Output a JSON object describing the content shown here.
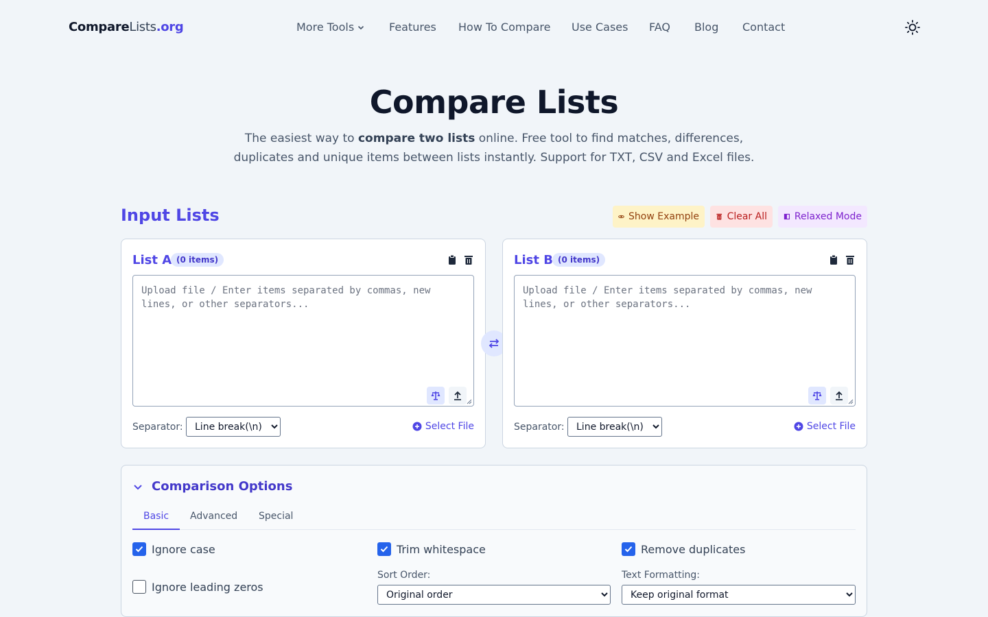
{
  "brand": {
    "part1": "Compare",
    "part2": "Lists",
    "part3": ".org"
  },
  "nav": [
    "More Tools",
    "Features",
    "How To Compare",
    "Use Cases",
    "FAQ",
    "Blog",
    "Contact"
  ],
  "hero": {
    "title": "Compare Lists",
    "sub_pre": "The easiest way to ",
    "sub_bold": "compare two lists",
    "sub_post": " online. Free tool to find matches, differences, duplicates and unique items between lists instantly. Support for TXT, CSV and Excel files."
  },
  "input": {
    "title": "Input Lists",
    "show_example": "Show Example",
    "clear_all": "Clear All",
    "relaxed_mode": "Relaxed Mode"
  },
  "lists": {
    "a": {
      "title": "List A",
      "count": "(0 items)",
      "placeholder": "Upload file / Enter items separated by commas, new lines, or other separators...",
      "separator_label": "Separator:",
      "separator": "Line break(\\n)",
      "select_file": "Select File"
    },
    "b": {
      "title": "List B",
      "count": "(0 items)",
      "placeholder": "Upload file / Enter items separated by commas, new lines, or other separators...",
      "separator_label": "Separator:",
      "separator": "Line break(\\n)",
      "select_file": "Select File"
    }
  },
  "options": {
    "title": "Comparison Options",
    "tabs": [
      "Basic",
      "Advanced",
      "Special"
    ],
    "ignore_case": "Ignore case",
    "trim_whitespace": "Trim whitespace",
    "remove_duplicates": "Remove duplicates",
    "ignore_leading_zeros": "Ignore leading zeros",
    "sort_label": "Sort Order:",
    "sort_value": "Original order",
    "format_label": "Text Formatting:",
    "format_value": "Keep original format"
  },
  "colors": {
    "accent": "#4f46e5",
    "checkbox": "#2563eb",
    "background": "#f1f5f9"
  }
}
